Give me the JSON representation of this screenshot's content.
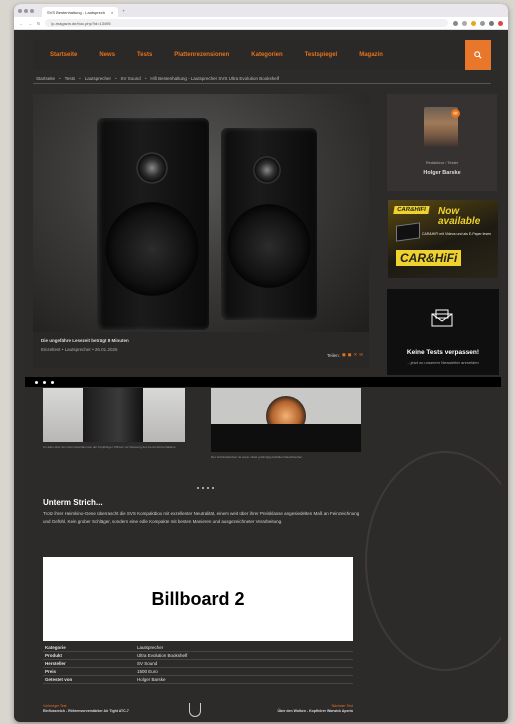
{
  "browser": {
    "tab_title": "SVS Bestenhaltung - Lautsprech",
    "new_tab": "+",
    "url": "lp-magazin.de/hoc.php?id=13495"
  },
  "nav": {
    "items": [
      "Startseite",
      "News",
      "Tests",
      "Plattenrezensionen",
      "Kategorien",
      "Testspiegel",
      "Magazin"
    ],
    "search_icon": "search-icon"
  },
  "breadcrumb": [
    "Startseite",
    "Tests",
    "Lautsprecher",
    "SV Sound",
    "Hifi Bestenhaltung - Lautsprecher SVS Ultra Evolution Bookshelf"
  ],
  "hero": {
    "caption_title": "Die ungefähre Lesezeit beträgt 8 Minuten",
    "caption_meta": "Einzeltest • Lautsprecher • 26.01.2025",
    "share_label": "Teilen:"
  },
  "author": {
    "role": "Redakteur / Tester",
    "name": "Holger Barske"
  },
  "ad": {
    "brand": "CAR&HIFI",
    "headline": "Now available",
    "sub": "CAR&HIFI mit Videos und als E-Paper lesen",
    "brand_big": "CAR&HiFi"
  },
  "newsletter": {
    "title": "Keine Tests verpassen!",
    "sub": "...jetzt zu unserem Newsletter anmelden"
  },
  "gallery": {
    "caption1": "An allen über den Gummiverlänertun der Kopfbörger Offnuer zur Messung des Kenntnitsrverhaltens",
    "caption2": "Der Verbindwindner ist seine mittel großzügig befüllten Rauchbecher"
  },
  "article": {
    "heading": "Unterm Strich...",
    "body": "Trotz ihrer Heimkino-Gene überrascht die SVS Kompaktbox mit exzellenter Neutralität, einem weit über ihrer Preisklasse angesiedelten Maß an Feinzeichnung und Gefühl. Kein grober Schläger, sondern eine edle Kompakte mit besten Manieren und ausgezeichneter Verarbeitung."
  },
  "billboard": {
    "label": "Billboard 2"
  },
  "specs": [
    {
      "k": "Kategorie",
      "v": "Lautsprecher"
    },
    {
      "k": "Produkt",
      "v": "Ultra Evolution Bookshelf"
    },
    {
      "k": "Hersteller",
      "v": "SV Sound"
    },
    {
      "k": "Preis",
      "v": "1500 Euro"
    },
    {
      "k": "Getestet von",
      "v": "Holger Barske"
    }
  ],
  "footer_nav": {
    "prev_label": "Vorheriger Test",
    "prev_title": "Einflussreich - Röhrenvorverstärker Air Tight ATC-7",
    "next_label": "Nächster Test",
    "next_title": "Über den Wolken - Kopfhörer Warwick Aperio"
  },
  "colors": {
    "accent": "#e5731b",
    "page_bg": "#2d2a2a"
  }
}
